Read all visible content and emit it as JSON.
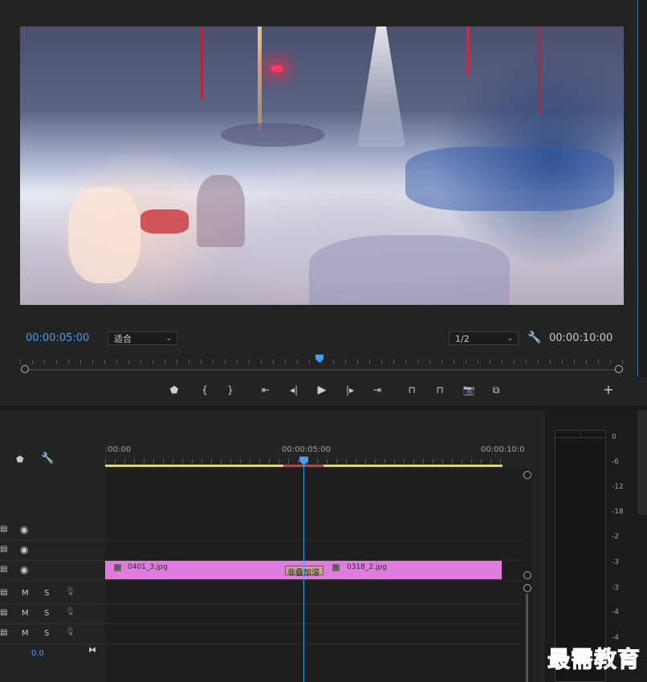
{
  "monitor": {
    "current_time": "00:00:05:00",
    "duration": "00:00:10:00",
    "fit_label": "适合",
    "resolution_label": "1/2",
    "playhead_fraction": 0.5
  },
  "transport": {
    "icons": [
      "marker-icon",
      "mark-in-icon",
      "mark-out-icon",
      "go-to-in-icon",
      "step-back-icon",
      "play-icon",
      "step-forward-icon",
      "go-to-out-icon",
      "lift-icon",
      "extract-icon",
      "camera-icon",
      "compare-icon",
      "add-icon"
    ]
  },
  "timeline": {
    "ruler_labels": [
      ":00:00",
      "00:00:05:00",
      "00:00:10:0"
    ],
    "tracks": {
      "v3": {
        "label": ""
      },
      "v2": {
        "label": ""
      },
      "v1": {
        "label": ""
      },
      "a1": {
        "m": "M",
        "s": "S"
      },
      "a2": {
        "m": "M",
        "s": "S"
      },
      "a3": {
        "m": "M",
        "s": "S"
      }
    },
    "master_value": "0.0",
    "clips": [
      {
        "name": "0401_3.jpg",
        "fx": "fx"
      },
      {
        "name": "0318_2.jpg",
        "fx": "fx"
      }
    ],
    "transition_label": "非叠加溶"
  },
  "meters": {
    "scale": [
      "0",
      "-6",
      "-12",
      "-18",
      "-2",
      "-3",
      "-3",
      "-4",
      "-4"
    ]
  },
  "watermark": "最需教育",
  "colors": {
    "accent_blue": "#4a9cf2",
    "clip_pink": "#e07ce0",
    "work_area_yellow": "#e5d84a"
  }
}
